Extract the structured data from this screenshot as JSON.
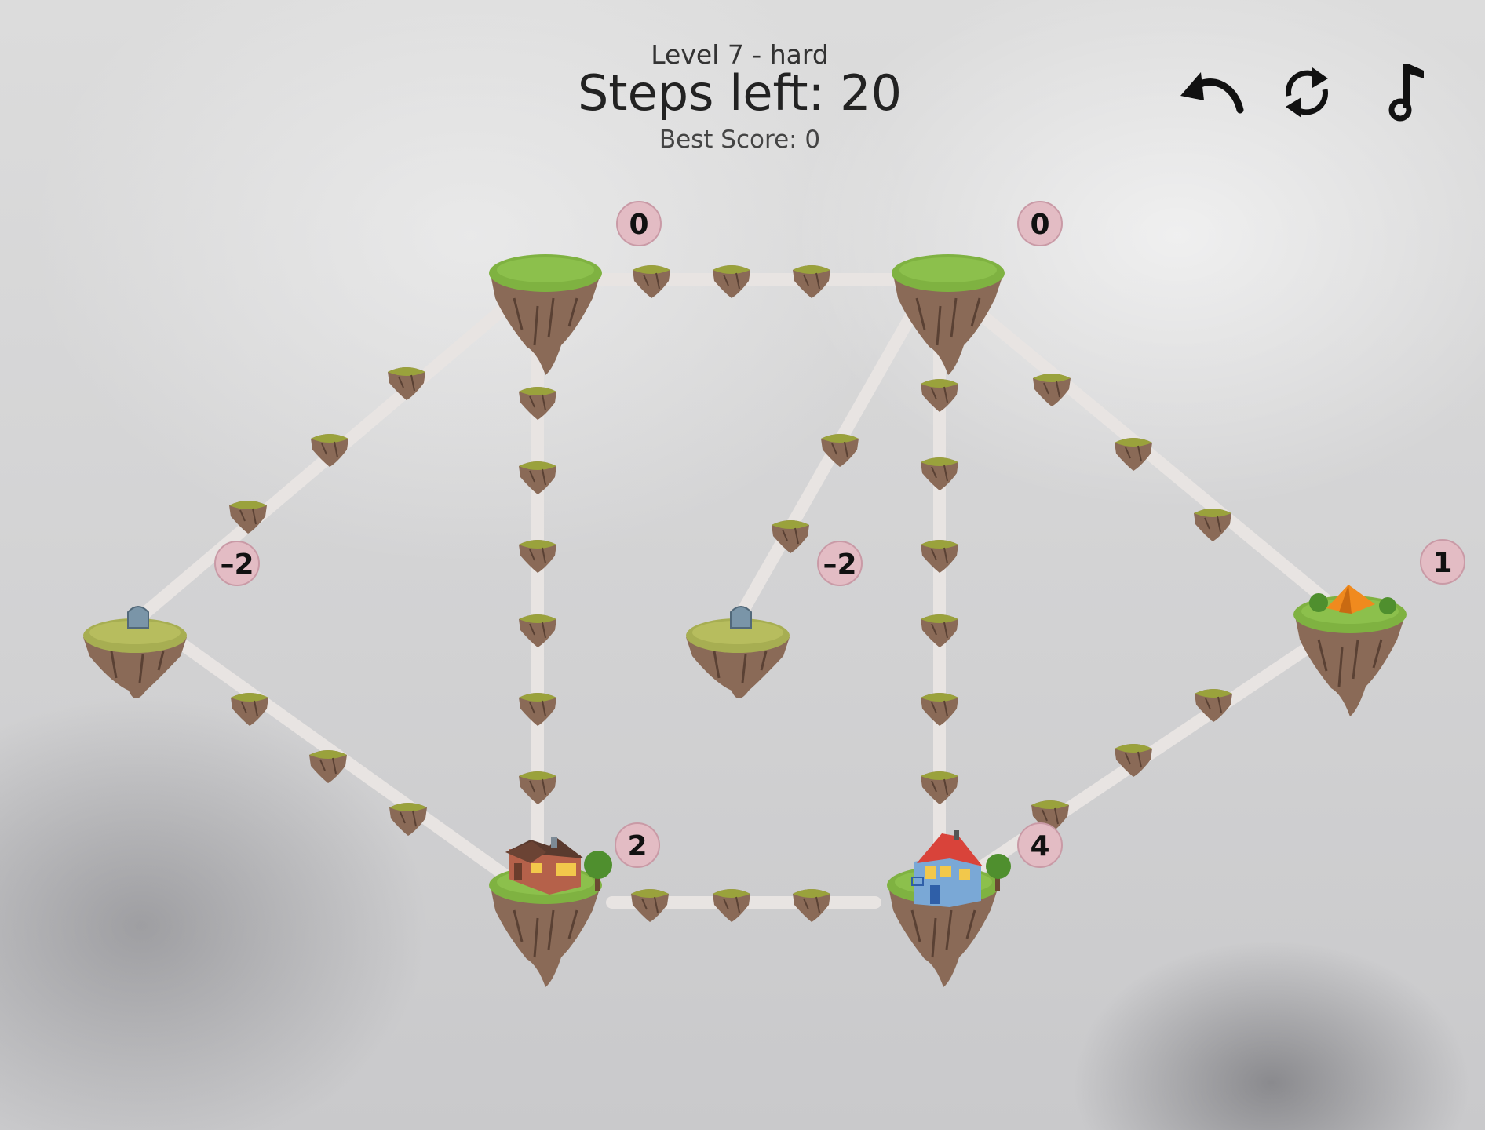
{
  "hud": {
    "level_label": "Level 7 - hard",
    "steps_label": "Steps left: 20",
    "best_label": "Best Score: 0"
  },
  "controls": [
    "undo-icon",
    "restart-icon",
    "music-icon"
  ],
  "colors": {
    "path": "#e8e4e2",
    "grass": "#7fb241",
    "rock": "#8a6a57",
    "rock_dark": "#6a4e3f",
    "badge": "#e3bcc4",
    "house_brick": "#b5614a",
    "house_blue": "#7aa8d6",
    "house_roof_red": "#d9433a",
    "tent": "#f08a1e"
  },
  "islands": [
    {
      "name": "top-left-island",
      "kind": "empty",
      "badge": "0"
    },
    {
      "name": "top-right-island",
      "kind": "empty",
      "badge": "0"
    },
    {
      "name": "left-grave-island",
      "kind": "grave",
      "badge": "–2"
    },
    {
      "name": "center-grave-island",
      "kind": "grave",
      "badge": "–2"
    },
    {
      "name": "tent-island",
      "kind": "tent",
      "badge": "1"
    },
    {
      "name": "brick-house-island",
      "kind": "brick-house",
      "badge": "2"
    },
    {
      "name": "blue-house-island",
      "kind": "blue-house",
      "badge": "4"
    }
  ]
}
